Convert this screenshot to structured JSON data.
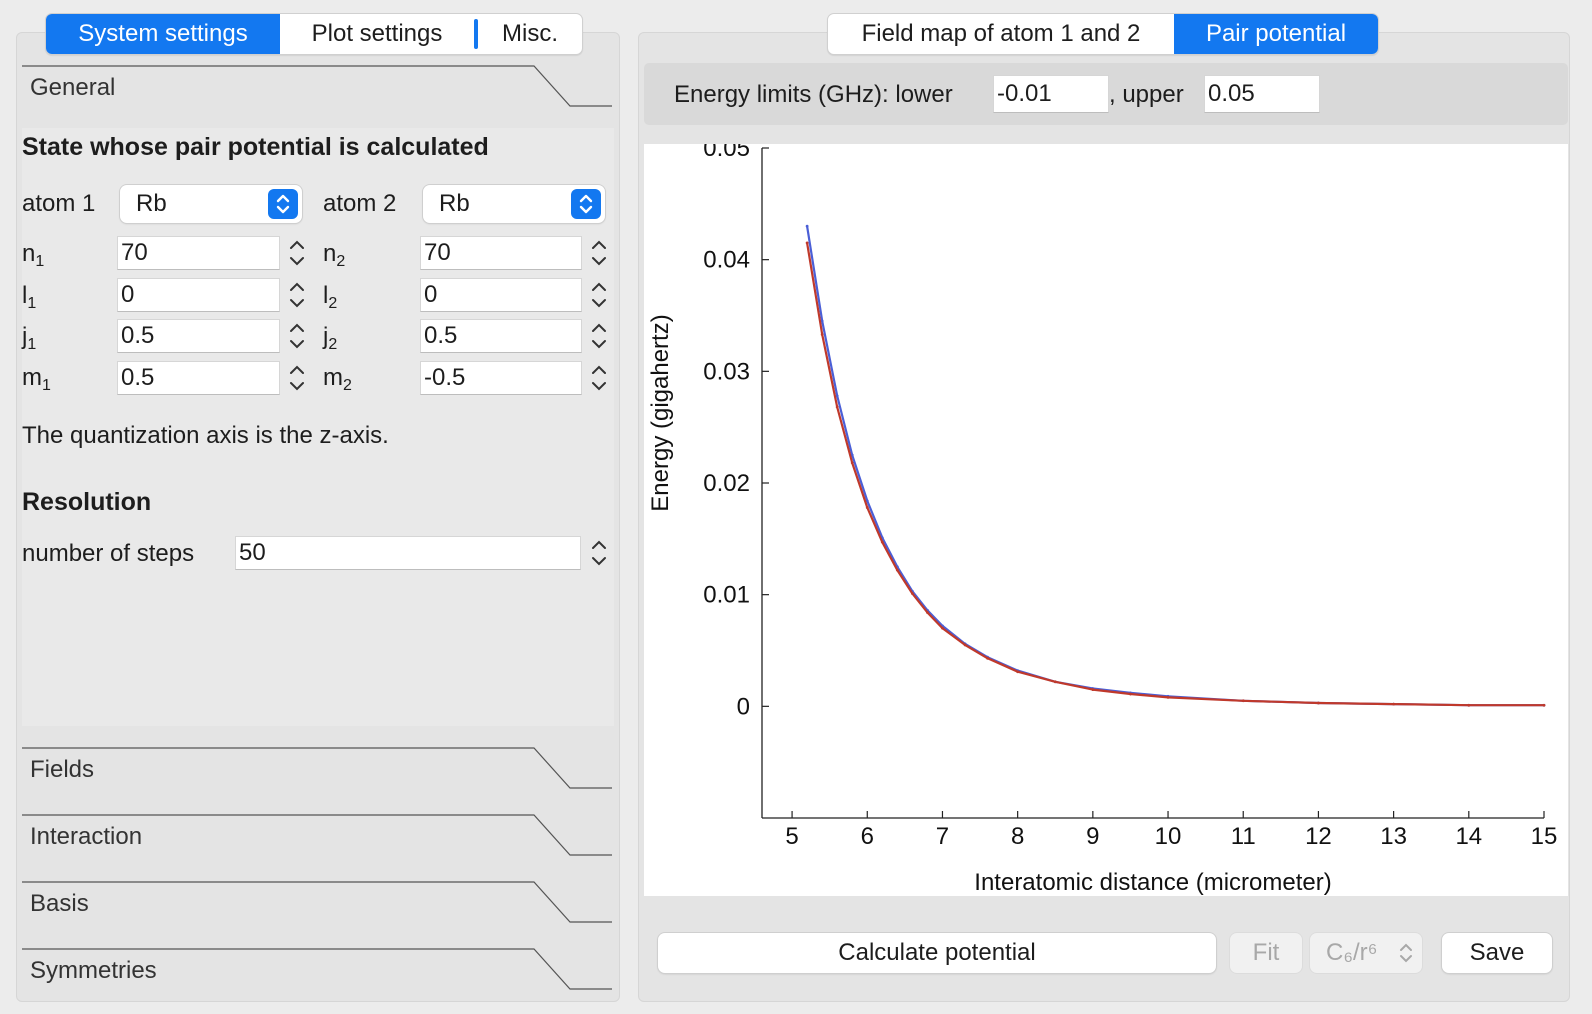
{
  "left_tabs": [
    "System settings",
    "Plot settings",
    "Misc."
  ],
  "sections": {
    "general": "General",
    "fields": "Fields",
    "interaction": "Interaction",
    "basis": "Basis",
    "symmetries": "Symmetries"
  },
  "general": {
    "state_title": "State whose pair potential is calculated",
    "atom1_label": "atom 1",
    "atom1_value": "Rb",
    "atom2_label": "atom 2",
    "atom2_value": "Rb",
    "params": [
      {
        "sym": "n",
        "sub1": "1",
        "v1": "70",
        "sub2": "2",
        "v2": "70"
      },
      {
        "sym": "l",
        "sub1": "1",
        "v1": "0",
        "sub2": "2",
        "v2": "0"
      },
      {
        "sym": "j",
        "sub1": "1",
        "v1": "0.5",
        "sub2": "2",
        "v2": "0.5"
      },
      {
        "sym": "m",
        "sub1": "1",
        "v1": "0.5",
        "sub2": "2",
        "v2": "-0.5"
      }
    ],
    "quantization_note": "The quantization axis is the z-axis.",
    "resolution_title": "Resolution",
    "steps_label": "number of steps",
    "steps_value": "50"
  },
  "right_tabs": [
    "Field map of atom 1 and 2",
    "Pair potential"
  ],
  "energy_limits": {
    "label": "Energy limits (GHz): lower",
    "lower": "-0.01",
    "upper_label": ", upper",
    "upper": "0.05"
  },
  "buttons": {
    "calculate": "Calculate potential",
    "fit": "Fit",
    "fit_model": "C₆/r⁶",
    "save": "Save"
  },
  "chart_data": {
    "type": "line",
    "xlabel": "Interatomic distance (micrometer)",
    "ylabel": "Energy (gigahertz)",
    "xlim": [
      4.6,
      15
    ],
    "ylim": [
      -0.01,
      0.05
    ],
    "xticks": [
      "5",
      "6",
      "7",
      "8",
      "9",
      "10",
      "11",
      "12",
      "13",
      "14",
      "15"
    ],
    "yticks": [
      "0",
      "0.01",
      "0.02",
      "0.03",
      "0.04",
      "0.05"
    ],
    "grid": false,
    "series": [
      {
        "color": "#4b5fd6",
        "x": [
          5.2,
          5.4,
          5.6,
          5.8,
          6.0,
          6.2,
          6.4,
          6.6,
          6.8,
          7.0,
          7.3,
          7.6,
          8.0,
          8.5,
          9.0,
          9.5,
          10,
          11,
          12,
          13,
          14,
          15
        ],
        "y": [
          0.043,
          0.0345,
          0.0278,
          0.0225,
          0.0184,
          0.0151,
          0.0125,
          0.0103,
          0.0086,
          0.0072,
          0.0056,
          0.0044,
          0.0032,
          0.0022,
          0.0016,
          0.0012,
          0.0009,
          0.0005,
          0.0003,
          0.0002,
          0.0001,
          0.0001
        ]
      },
      {
        "color": "#c0392b",
        "x": [
          5.2,
          5.4,
          5.6,
          5.8,
          6.0,
          6.2,
          6.4,
          6.6,
          6.8,
          7.0,
          7.3,
          7.6,
          8.0,
          8.5,
          9.0,
          9.5,
          10,
          11,
          12,
          13,
          14,
          15
        ],
        "y": [
          0.0415,
          0.0333,
          0.0268,
          0.0218,
          0.0178,
          0.0147,
          0.0122,
          0.0101,
          0.0084,
          0.007,
          0.0055,
          0.0043,
          0.0031,
          0.0022,
          0.0015,
          0.0011,
          0.0008,
          0.0005,
          0.0003,
          0.0002,
          0.0001,
          0.0001
        ]
      }
    ]
  }
}
